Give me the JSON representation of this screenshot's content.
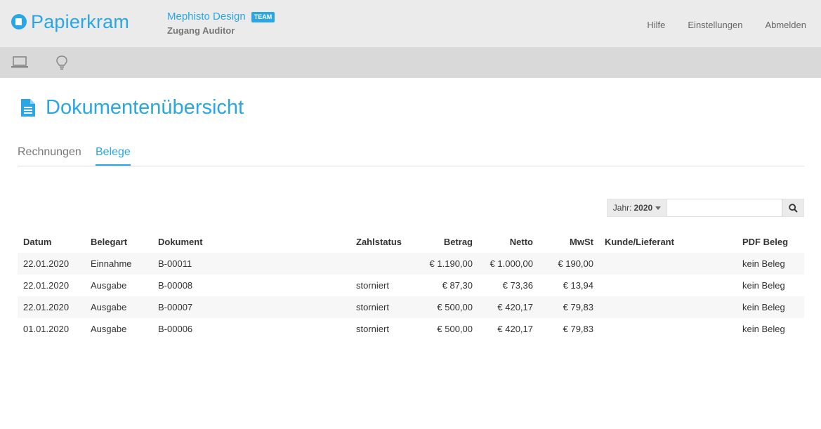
{
  "brand": {
    "name": "Papierkram"
  },
  "account": {
    "company": "Mephisto Design",
    "badge": "TEAM",
    "user": "Zugang Auditor"
  },
  "nav": {
    "help": "Hilfe",
    "settings": "Einstellungen",
    "logout": "Abmelden"
  },
  "toolbar": {
    "icons": [
      "laptop-icon",
      "lightbulb-icon"
    ]
  },
  "page": {
    "title": "Dokumentenübersicht",
    "icon": "document-icon"
  },
  "tabs": [
    {
      "label": "Rechnungen",
      "active": false
    },
    {
      "label": "Belege",
      "active": true
    }
  ],
  "filter": {
    "year_label": "Jahr:",
    "year_value": "2020",
    "search_value": "",
    "search_placeholder": ""
  },
  "table": {
    "columns": [
      "Datum",
      "Belegart",
      "Dokument",
      "Zahlstatus",
      "Betrag",
      "Netto",
      "MwSt",
      "Kunde/Lieferant",
      "PDF Beleg"
    ],
    "rows": [
      {
        "datum": "22.01.2020",
        "belegart": "Einnahme",
        "dokument": "B-00011",
        "zahlstatus": "",
        "betrag": "€ 1.190,00",
        "netto": "€ 1.000,00",
        "mwst": "€ 190,00",
        "kunde": "",
        "pdf": "kein Beleg"
      },
      {
        "datum": "22.01.2020",
        "belegart": "Ausgabe",
        "dokument": "B-00008",
        "zahlstatus": "storniert",
        "betrag": "€ 87,30",
        "netto": "€ 73,36",
        "mwst": "€ 13,94",
        "kunde": "",
        "pdf": "kein Beleg"
      },
      {
        "datum": "22.01.2020",
        "belegart": "Ausgabe",
        "dokument": "B-00007",
        "zahlstatus": "storniert",
        "betrag": "€ 500,00",
        "netto": "€ 420,17",
        "mwst": "€ 79,83",
        "kunde": "",
        "pdf": "kein Beleg"
      },
      {
        "datum": "01.01.2020",
        "belegart": "Ausgabe",
        "dokument": "B-00006",
        "zahlstatus": "storniert",
        "betrag": "€ 500,00",
        "netto": "€ 420,17",
        "mwst": "€ 79,83",
        "kunde": "",
        "pdf": "kein Beleg"
      }
    ]
  },
  "colors": {
    "accent": "#2aa6e4",
    "header_bg": "#ebebeb",
    "subbar_bg": "#d9d9d9"
  }
}
